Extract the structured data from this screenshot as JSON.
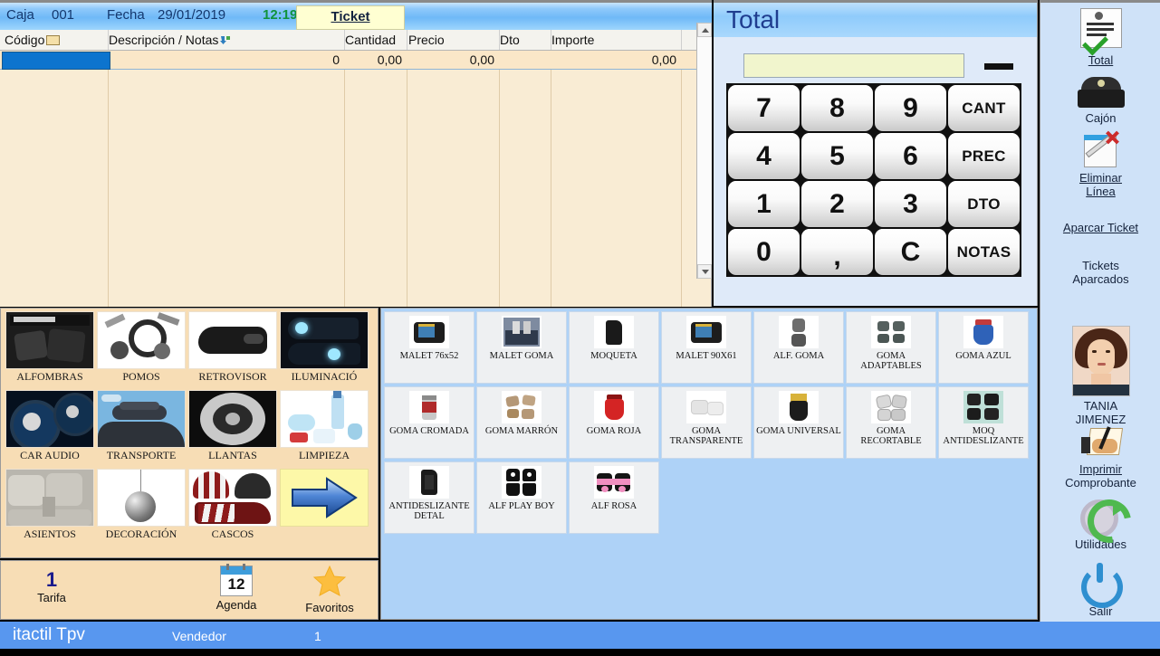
{
  "header": {
    "caja_label": "Caja",
    "caja_value": "001",
    "fecha_label": "Fecha",
    "fecha_value": "29/01/2019",
    "hora_value": "12:19",
    "tab_label": "Ticket"
  },
  "ticket_grid": {
    "columns": [
      "Código",
      "Descripción / Notas",
      "Cantidad",
      "Precio",
      "Dto",
      "Importe"
    ],
    "rows": [
      {
        "codigo": "",
        "descripcion": "",
        "cantidad": "0",
        "precio": "0,00",
        "dto": "0,00",
        "importe": "0,00"
      }
    ]
  },
  "total_panel": {
    "title": "Total",
    "display_value": "",
    "minus_label": "−",
    "keypad": [
      {
        "label": "7",
        "kind": "num"
      },
      {
        "label": "8",
        "kind": "num"
      },
      {
        "label": "9",
        "kind": "num"
      },
      {
        "label": "CANT",
        "kind": "fn"
      },
      {
        "label": "4",
        "kind": "num"
      },
      {
        "label": "5",
        "kind": "num"
      },
      {
        "label": "6",
        "kind": "num"
      },
      {
        "label": "PREC",
        "kind": "fn"
      },
      {
        "label": "1",
        "kind": "num"
      },
      {
        "label": "2",
        "kind": "num"
      },
      {
        "label": "3",
        "kind": "num"
      },
      {
        "label": "DTO",
        "kind": "fn"
      },
      {
        "label": "0",
        "kind": "num"
      },
      {
        "label": ",",
        "kind": "comma"
      },
      {
        "label": "C",
        "kind": "num"
      },
      {
        "label": "NOTAS",
        "kind": "fn"
      }
    ]
  },
  "sidebar": {
    "items": [
      {
        "label": "Total",
        "icon": "ticket-check-icon"
      },
      {
        "label": "Cajón",
        "icon": "cash-drawer-icon"
      },
      {
        "label_line1": "Eliminar",
        "label_line2": "Línea",
        "icon": "delete-line-icon"
      },
      {
        "label": "Aparcar Ticket",
        "icon": "none"
      },
      {
        "label_line1": "Tickets",
        "label_line2": "Aparcados",
        "icon": "none"
      },
      {
        "label_line1": "TANIA",
        "label_line2": "JIMENEZ",
        "icon": "user-photo-icon"
      },
      {
        "label_line1": "Imprimir",
        "label_line2": "Comprobante",
        "icon": "print-receipt-icon"
      },
      {
        "label": "Utilidades",
        "icon": "gear-refresh-icon"
      },
      {
        "label": "Salir",
        "icon": "power-icon"
      }
    ]
  },
  "categories": [
    {
      "label": "ALFOMBRAS",
      "art": "alfombras"
    },
    {
      "label": "POMOS",
      "art": "pomos"
    },
    {
      "label": "RETROVISOR",
      "art": "retrovisor"
    },
    {
      "label": "ILUMINACIÓ",
      "art": "iluminacion"
    },
    {
      "label": "CAR AUDIO",
      "art": "caraudio"
    },
    {
      "label": "TRANSPORTE",
      "art": "transporte"
    },
    {
      "label": "LLANTAS",
      "art": "llantas"
    },
    {
      "label": "LIMPIEZA",
      "art": "limpieza"
    },
    {
      "label": "ASIENTOS",
      "art": "asientos"
    },
    {
      "label": "DECORACIÓN",
      "art": "decoracion"
    },
    {
      "label": "CASCOS",
      "art": "cascos"
    },
    {
      "label": "",
      "art": "next-arrow"
    }
  ],
  "products": [
    {
      "label": "MALET 76x52",
      "art": "malet"
    },
    {
      "label": "MALET GOMA",
      "art": "maletgoma"
    },
    {
      "label": "MOQUETA",
      "art": "moqueta"
    },
    {
      "label": "MALET 90X61",
      "art": "malet"
    },
    {
      "label": "ALF. GOMA",
      "art": "alfgoma"
    },
    {
      "label": "GOMA ADAPTABLES",
      "art": "adaptables"
    },
    {
      "label": "GOMA AZUL",
      "art": "azul"
    },
    {
      "label": "GOMA CROMADA",
      "art": "cromada"
    },
    {
      "label": "GOMA MARRÓN",
      "art": "marron"
    },
    {
      "label": "GOMA ROJA",
      "art": "roja"
    },
    {
      "label": "GOMA TRANSPARENTE",
      "art": "transparente"
    },
    {
      "label": "GOMA UNIVERSAL",
      "art": "universal"
    },
    {
      "label": "GOMA RECORTABLE",
      "art": "recortable"
    },
    {
      "label": "MOQ ANTIDESLIZANTE",
      "art": "moqanti"
    },
    {
      "label": "ANTIDESLIZANTE DETAL",
      "art": "antidetal"
    },
    {
      "label": "ALF PLAY BOY",
      "art": "playboy"
    },
    {
      "label": "ALF ROSA",
      "art": "rosa"
    }
  ],
  "bottom_left": {
    "tarifa_number": "1",
    "tarifa_label": "Tarifa",
    "agenda_label": "Agenda",
    "agenda_day": "12",
    "favoritos_label": "Favoritos"
  },
  "statusbar": {
    "app_name": "itactil Tpv",
    "vendedor_label": "Vendedor",
    "vendedor_value": "1"
  }
}
